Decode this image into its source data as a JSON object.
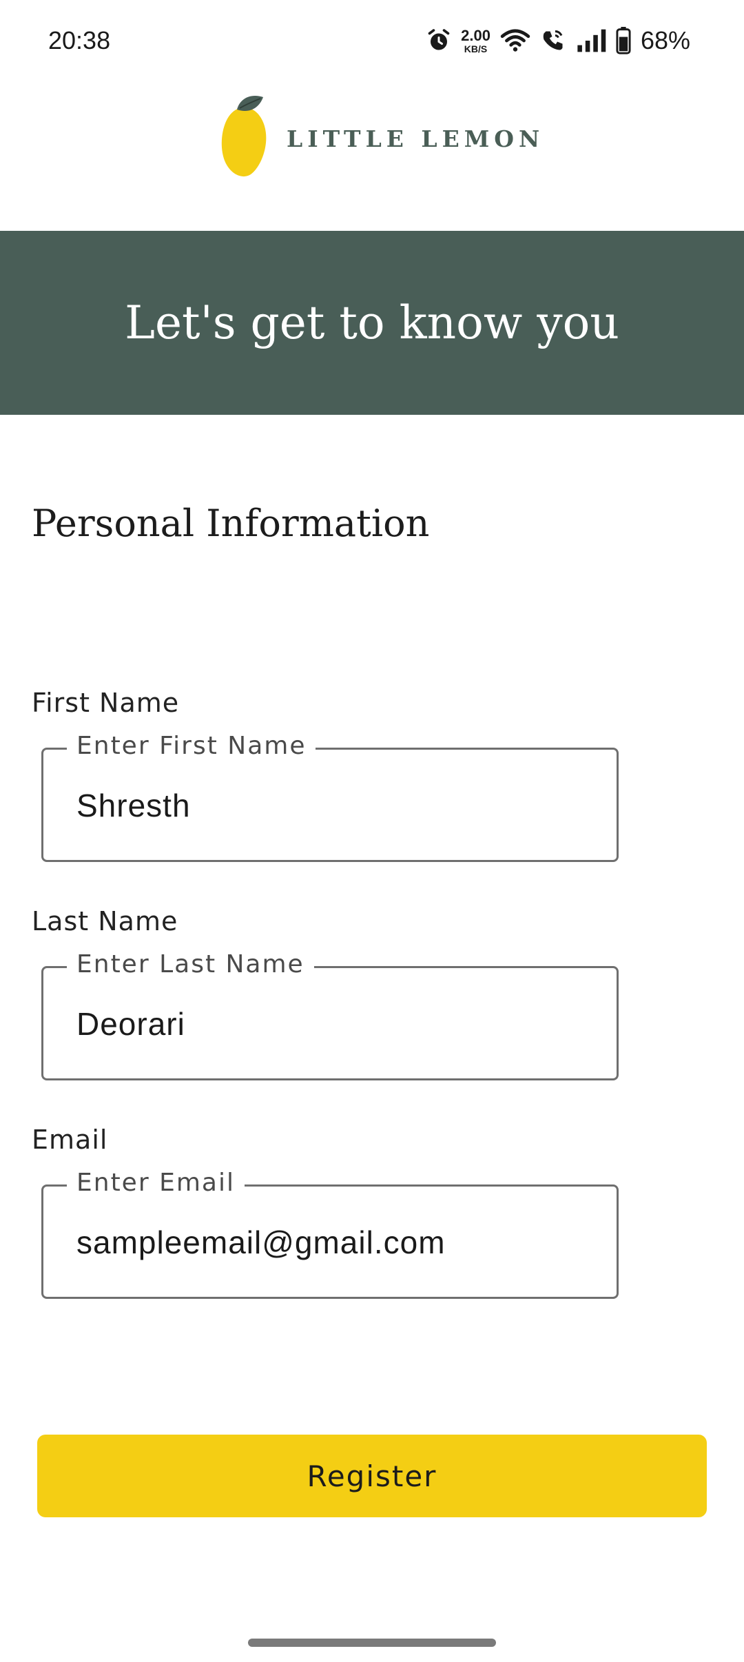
{
  "status_bar": {
    "time": "20:38",
    "net_speed_value": "2.00",
    "net_speed_unit": "KB/S",
    "battery_percent": "68%"
  },
  "logo": {
    "text": "LITTLE LEMON",
    "brand_yellow": "#F4CE14",
    "brand_green": "#495E57"
  },
  "hero": {
    "title": "Let's get to know you"
  },
  "form": {
    "section_title": "Personal Information",
    "first_name": {
      "label": "First Name",
      "placeholder": "Enter First Name",
      "value": "Shresth"
    },
    "last_name": {
      "label": "Last Name",
      "placeholder": "Enter Last Name",
      "value": "Deorari"
    },
    "email": {
      "label": "Email",
      "placeholder": "Enter Email",
      "value": "sampleemail@gmail.com"
    },
    "register_label": "Register"
  }
}
